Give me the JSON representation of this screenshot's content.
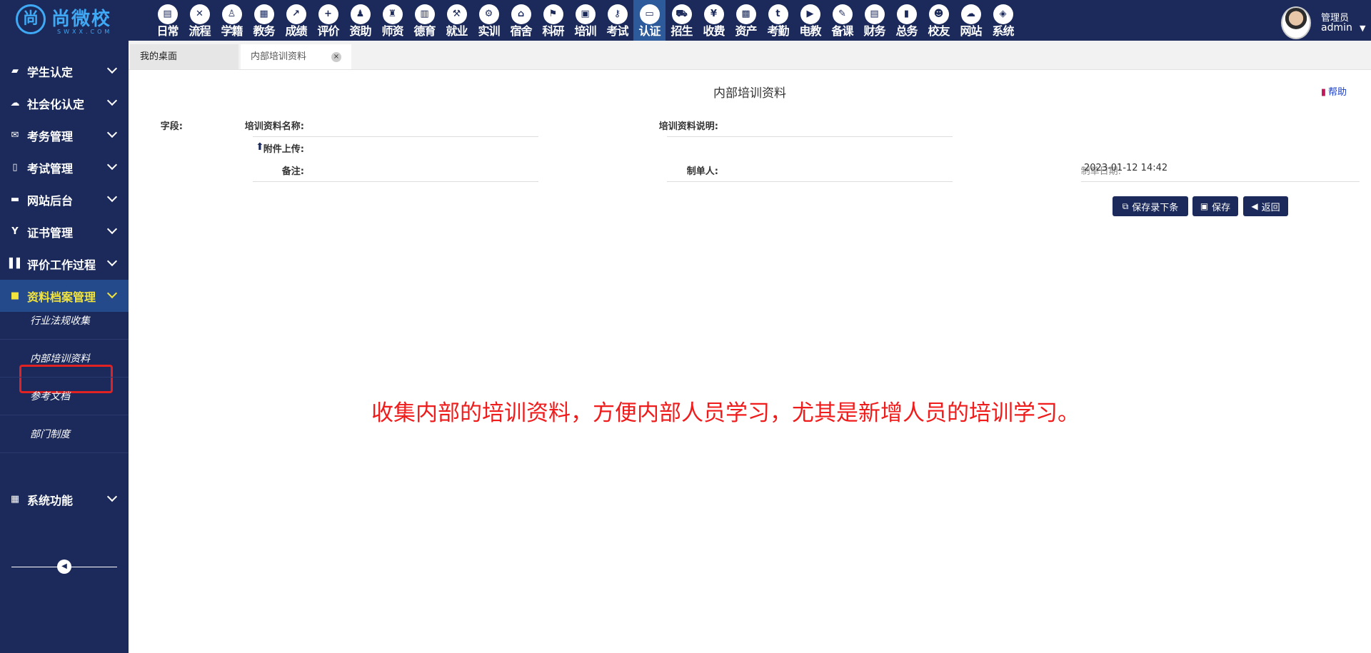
{
  "brand": {
    "name": "尚微校",
    "domain": "SWXX.COM",
    "mark": "尚"
  },
  "nav": [
    {
      "label": "日常",
      "icon": "document-icon",
      "glyph": "▤"
    },
    {
      "label": "流程",
      "icon": "flow-icon",
      "glyph": "✕"
    },
    {
      "label": "学籍",
      "icon": "student-icon",
      "glyph": "♙"
    },
    {
      "label": "教务",
      "icon": "calendar-icon",
      "glyph": "▦"
    },
    {
      "label": "成绩",
      "icon": "chart-line-icon",
      "glyph": "↗"
    },
    {
      "label": "评价",
      "icon": "calendar-plus-icon",
      "glyph": "+"
    },
    {
      "label": "资助",
      "icon": "aid-icon",
      "glyph": "♟"
    },
    {
      "label": "师资",
      "icon": "teacher-icon",
      "glyph": "♜"
    },
    {
      "label": "德育",
      "icon": "book-icon",
      "glyph": "▥"
    },
    {
      "label": "就业",
      "icon": "gavel-icon",
      "glyph": "⚒"
    },
    {
      "label": "实训",
      "icon": "training-icon",
      "glyph": "⚙"
    },
    {
      "label": "宿舍",
      "icon": "home-icon",
      "glyph": "⌂"
    },
    {
      "label": "科研",
      "icon": "graduation-icon",
      "glyph": "⚑"
    },
    {
      "label": "培训",
      "icon": "image-icon",
      "glyph": "▣"
    },
    {
      "label": "考试",
      "icon": "key-icon",
      "glyph": "⚷"
    },
    {
      "label": "认证",
      "icon": "monitor-icon",
      "glyph": "▭"
    },
    {
      "label": "招生",
      "icon": "bus-icon",
      "glyph": "⛟"
    },
    {
      "label": "收费",
      "icon": "yen-icon",
      "glyph": "¥"
    },
    {
      "label": "资产",
      "icon": "train-icon",
      "glyph": "▩"
    },
    {
      "label": "考勤",
      "icon": "tumblr-icon",
      "glyph": "t"
    },
    {
      "label": "电教",
      "icon": "media-icon",
      "glyph": "▶"
    },
    {
      "label": "备课",
      "icon": "edit-icon",
      "glyph": "✎"
    },
    {
      "label": "财务",
      "icon": "newspaper-icon",
      "glyph": "▤"
    },
    {
      "label": "总务",
      "icon": "bar-chart-icon",
      "glyph": "▮"
    },
    {
      "label": "校友",
      "icon": "users-icon",
      "glyph": "☻"
    },
    {
      "label": "网站",
      "icon": "cloud-icon",
      "glyph": "☁"
    },
    {
      "label": "系统",
      "icon": "cube-icon",
      "glyph": "◈"
    }
  ],
  "nav_active_index": 15,
  "user": {
    "role": "管理员",
    "name": "admin"
  },
  "sidebar": {
    "menus": [
      {
        "label": "学生认定",
        "icon": "book-icon",
        "glyph": "▰"
      },
      {
        "label": "社会化认定",
        "icon": "cloud-icon",
        "glyph": "☁"
      },
      {
        "label": "考务管理",
        "icon": "envelope-icon",
        "glyph": "✉"
      },
      {
        "label": "考试管理",
        "icon": "file-icon",
        "glyph": "▯"
      },
      {
        "label": "网站后台",
        "icon": "folder-icon",
        "glyph": "▬"
      },
      {
        "label": "证书管理",
        "icon": "certificate-icon",
        "glyph": "Y"
      },
      {
        "label": "评价工作过程",
        "icon": "columns-icon",
        "glyph": "▌▌"
      },
      {
        "label": "资料档案管理",
        "icon": "archive-icon",
        "glyph": "■"
      },
      {
        "label": "系统功能",
        "icon": "grid-icon",
        "glyph": "▦"
      }
    ],
    "sub_items": [
      "行业法规收集",
      "内部培训资料",
      "参考文档",
      "部门制度"
    ]
  },
  "tabs": {
    "home": "我的桌面",
    "current": "内部培训资料",
    "close": "×"
  },
  "page": {
    "title": "内部培训资料",
    "help": "帮助",
    "form": {
      "field_prefix": "字段:",
      "name_label": "培训资料名称:",
      "desc_label": "培训资料说明:",
      "attach_label": "附件上传:",
      "remark_label": "备注:",
      "creator_label": "制单人:",
      "date_label": "制单日期:",
      "date_value": "2023-01-12 14:42"
    },
    "buttons": {
      "save_next": "保存录下条",
      "save": "保存",
      "back": "返回"
    },
    "note": "收集内部的培训资料，方便内部人员学习，尤其是新增人员的培训学习。"
  }
}
